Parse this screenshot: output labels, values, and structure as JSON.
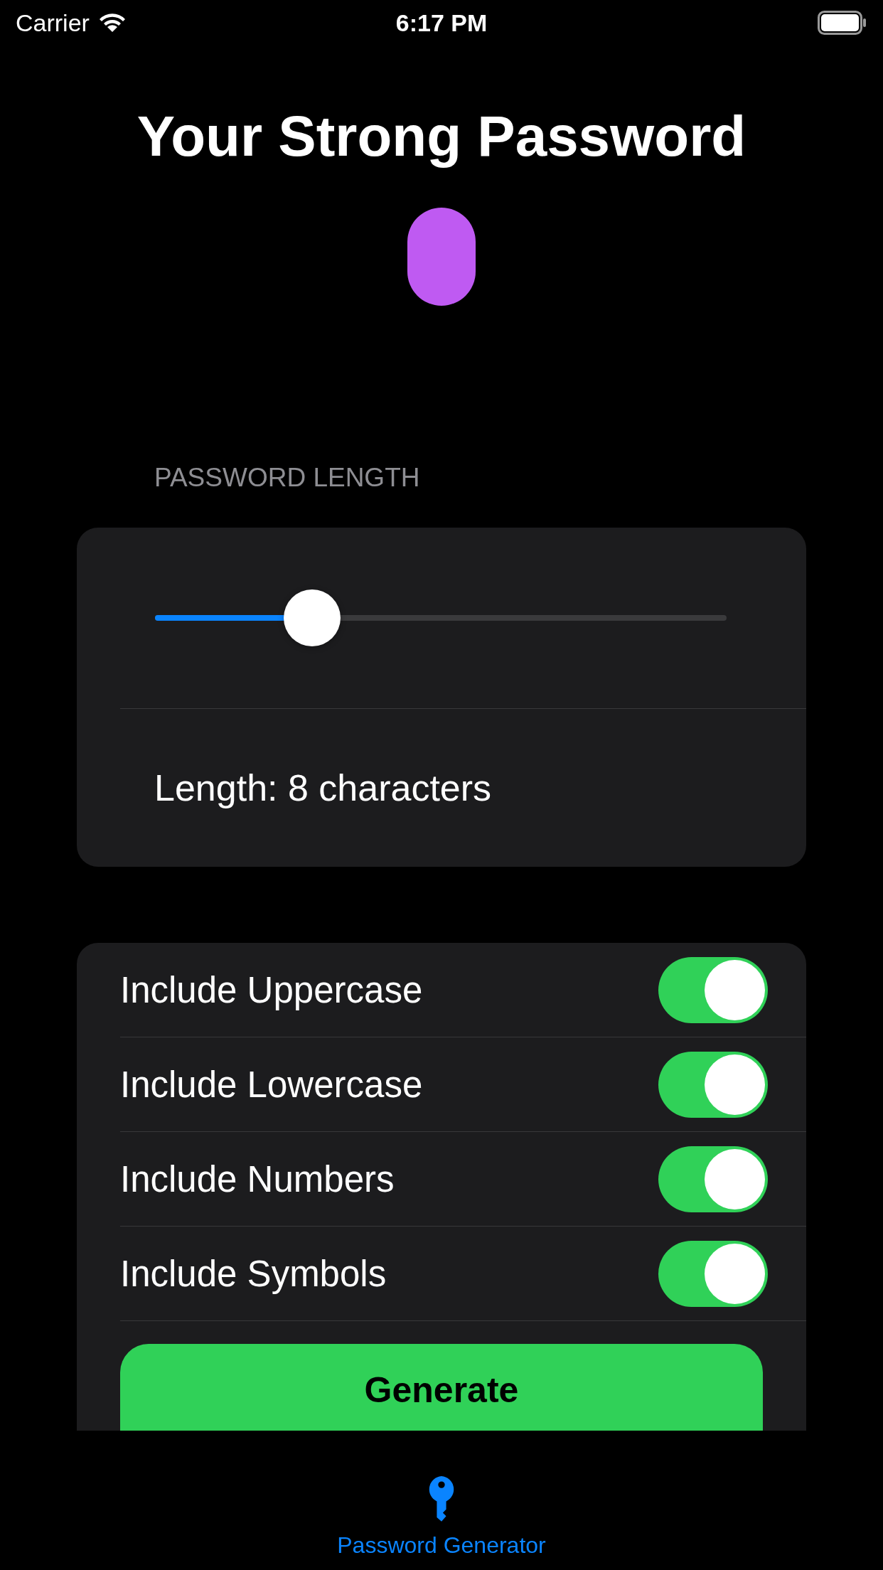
{
  "status_bar": {
    "carrier": "Carrier",
    "time": "6:17 PM"
  },
  "title": "Your Strong Password",
  "length_section": {
    "header": "PASSWORD LENGTH",
    "slider": {
      "level": 0.275
    },
    "length_label": "Length: 8 characters"
  },
  "options": [
    {
      "label": "Include Uppercase",
      "on": true
    },
    {
      "label": "Include Lowercase",
      "on": true
    },
    {
      "label": "Include Numbers",
      "on": true
    },
    {
      "label": "Include Symbols",
      "on": true
    }
  ],
  "generate_button": "Generate",
  "tab_bar": [
    {
      "label": "Password Generator",
      "selected": true
    }
  ]
}
